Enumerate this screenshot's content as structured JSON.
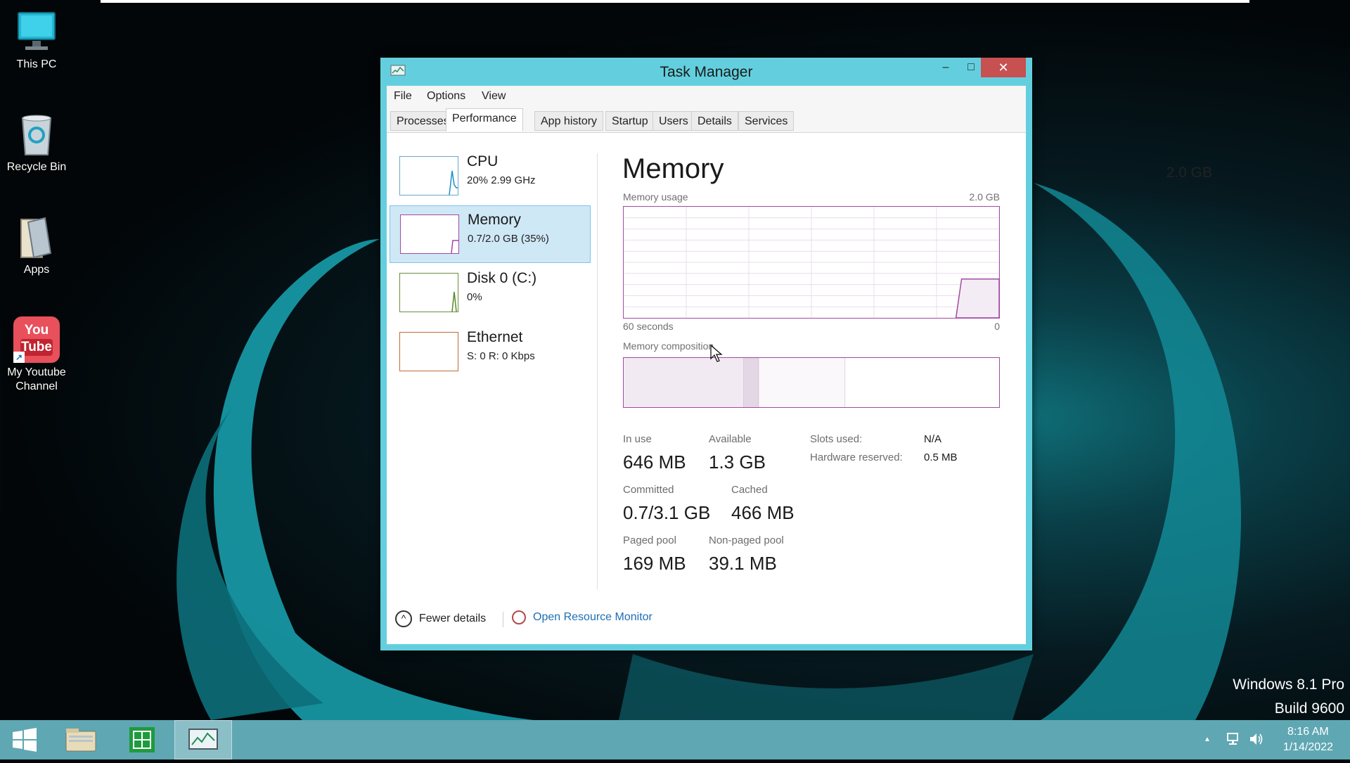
{
  "desktop": {
    "icons": [
      {
        "label": "This PC"
      },
      {
        "label": "Recycle Bin"
      },
      {
        "label": "Apps"
      },
      {
        "label": "My Youtube Channel"
      }
    ],
    "youtube_icon_text": {
      "top": "You",
      "bottom": "Tube"
    }
  },
  "window": {
    "title": "Task Manager",
    "controls": {
      "minimize": "–",
      "maximize": "□",
      "close": "✕"
    },
    "menu": [
      "File",
      "Options",
      "View"
    ],
    "tabs": [
      "Processes",
      "Performance",
      "App history",
      "Startup",
      "Users",
      "Details",
      "Services"
    ],
    "active_tab": "Performance"
  },
  "sidebar": [
    {
      "name": "CPU",
      "value": "20%  2.99 GHz"
    },
    {
      "name": "Memory",
      "value": "0.7/2.0 GB (35%)"
    },
    {
      "name": "Disk 0 (C:)",
      "value": "0%"
    },
    {
      "name": "Ethernet",
      "value": "S: 0 R: 0 Kbps"
    }
  ],
  "memory": {
    "title": "Memory",
    "total": "2.0 GB",
    "usage_label": "Memory usage",
    "usage_max": "2.0 GB",
    "time_left": "60 seconds",
    "time_right": "0",
    "composition_label": "Memory composition",
    "composition_fractions": {
      "in_use": 0.32,
      "modified": 0.04,
      "standby": 0.23,
      "free": 0.41
    },
    "usage_level_fraction": 0.35,
    "stats": {
      "in_use_label": "In use",
      "in_use": "646 MB",
      "available_label": "Available",
      "available": "1.3 GB",
      "committed_label": "Committed",
      "committed": "0.7/3.1 GB",
      "cached_label": "Cached",
      "cached": "466 MB",
      "paged_label": "Paged pool",
      "paged": "169 MB",
      "nonpaged_label": "Non-paged pool",
      "nonpaged": "39.1 MB"
    },
    "details": {
      "slots_label": "Slots used:",
      "slots": "N/A",
      "hw_label": "Hardware reserved:",
      "hw": "0.5 MB"
    }
  },
  "footer": {
    "fewer_details": "Fewer details",
    "open_resource_monitor": "Open Resource Monitor"
  },
  "taskbar": {
    "time": "8:16 AM",
    "date": "1/14/2022",
    "tray_arrow": "▲"
  },
  "watermark": {
    "line1": "Windows 8.1 Pro",
    "line2": "Build 9600"
  },
  "colors": {
    "window_frame": "#63cfde",
    "close_button": "#c75050",
    "memory_accent": "#a14aa3",
    "taskbar": "#5fa7b3",
    "link": "#1e6eb5"
  }
}
